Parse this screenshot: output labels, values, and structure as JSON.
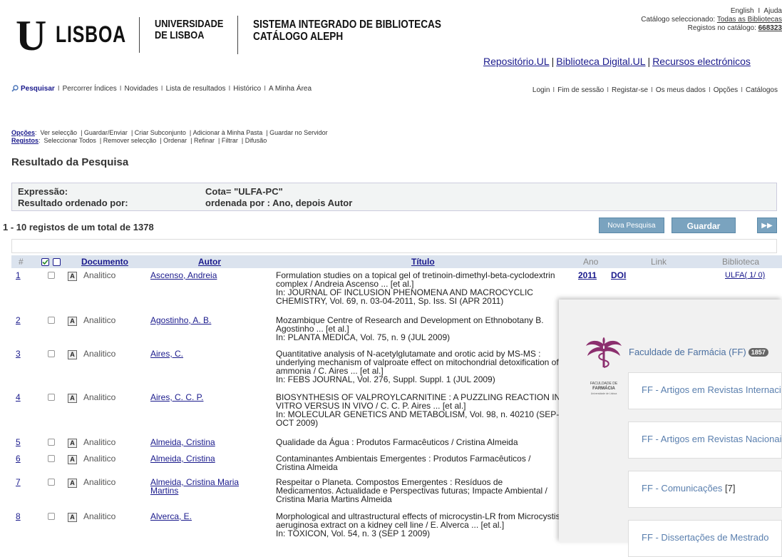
{
  "header": {
    "logo_u": "U",
    "logo_lisboa": "LISBOA",
    "university_line1": "UNIVERSIDADE",
    "university_line2": "DE LISBOA",
    "system_line1": "SISTEMA INTEGRADO DE BIBLIOTECAS",
    "system_line2": "CATÁLOGO ALEPH"
  },
  "top_right": {
    "english": "English",
    "help": "Ajuda",
    "catalog_label": "Catálogo seleccionado:",
    "catalog_value": "Todas as Bibliotecas",
    "records_label": "Registos no catálogo:",
    "records_value": "668323"
  },
  "resource_links": [
    "Repositório.UL",
    "Biblioteca Digital.UL",
    "Recursos electrónicos"
  ],
  "main_nav": [
    "Pesquisar",
    "Percorrer Índices",
    "Novidades",
    "Lista de resultados",
    "Histórico",
    "A Minha Área"
  ],
  "right_nav": [
    "Login",
    "Fim de sessão",
    "Registar-se",
    "Os meus dados",
    "Opções",
    "Catálogos"
  ],
  "options": {
    "label": "Opções",
    "items": [
      "Ver selecção",
      "Guardar/Enviar",
      "Criar Subconjunto",
      "Adicionar à Minha Pasta",
      "Guardar no Servidor"
    ]
  },
  "registos": {
    "label": "Registos",
    "items": [
      "Seleccionar Todos",
      "Remover selecção",
      "Ordenar",
      "Refinar",
      "Filtrar",
      "Difusão"
    ]
  },
  "result_title": "Resultado da Pesquisa",
  "expression": {
    "label": "Expressão:",
    "value": "Cota= \"ULFA-PC\"",
    "sort_label": "Resultado ordenado por:",
    "sort_value": "ordenada por : Ano, depois Autor"
  },
  "count_text": "1 - 10 registos de um total de 1378",
  "buttons": {
    "new_search": "Nova Pesquisa",
    "save": "Guardar",
    "next": "▶▶"
  },
  "table": {
    "headers": {
      "num": "#",
      "documento": "Documento",
      "autor": "Autor",
      "titulo": "Título",
      "ano": "Ano",
      "link": "Link",
      "biblioteca": "Biblioteca"
    },
    "rows": [
      {
        "num": "1",
        "doc": "Analitico",
        "autor": "Ascenso, Andreia",
        "titulo": "Formulation studies on a topical gel of tretinoin-dimethyl-beta-cyclodextrin complex / Andreia Ascenso ... [et al.]\nIn: JOURNAL OF INCLUSION PHENOMENA AND MACROCYCLIC CHEMISTRY, Vol. 69, n. 03-04-2011, Sp. Iss. SI (APR 2011)",
        "ano": "2011",
        "link": "DOI",
        "biblioteca": "ULFA( 1/ 0)"
      },
      {
        "num": "2",
        "doc": "Analitico",
        "autor": "Agostinho, A. B.",
        "titulo": "Mozambique Centre of Research and Development on Ethnobotany B. Agostinho ... [et al.]\nIn: PLANTA MEDICA, Vol. 75, n. 9 (JUL 2009)",
        "ano": "",
        "link": "",
        "biblioteca": ""
      },
      {
        "num": "3",
        "doc": "Analitico",
        "autor": "Aires, C.",
        "titulo": "Quantitative analysis of N-acetylglutamate and orotic acid by MS-MS : underlying mechanism of valproate effect on mitochondrial detoxification of ammonia / C. Aires ... [et al.]\nIn: FEBS JOURNAL, Vol. 276, Suppl. Suppl. 1 (JUL 2009)",
        "ano": "",
        "link": "",
        "biblioteca": ""
      },
      {
        "num": "4",
        "doc": "Analitico",
        "autor": "Aires, C. C. P.",
        "titulo": "BIOSYNTHESIS OF VALPROYLCARNITINE : A PUZZLING REACTION IN VITRO VERSUS IN VIVO / C. C. P. Aires ... [et al.]\nIn: MOLECULAR GENETICS AND METABOLISM, Vol. 98, n. 40210 (SEP-OCT 2009)",
        "ano": "",
        "link": "",
        "biblioteca": ""
      },
      {
        "num": "5",
        "doc": "Analitico",
        "autor": "Almeida, Cristina",
        "titulo": "Qualidade da Água : Produtos Farmacêuticos / Cristina Almeida",
        "ano": "",
        "link": "",
        "biblioteca": ""
      },
      {
        "num": "6",
        "doc": "Analitico",
        "autor": "Almeida, Cristina",
        "titulo": "Contaminantes Ambientais Emergentes : Produtos Farmacêuticos / Cristina Almeida",
        "ano": "",
        "link": "",
        "biblioteca": ""
      },
      {
        "num": "7",
        "doc": "Analitico",
        "autor": "Almeida, Cristina Maria Martins",
        "titulo": "Respeitar o Planeta. Compostos Emergentes : Resíduos de Medicamentos. Actualidade e Perspectivas futuras; Impacte Ambiental / Cristina Maria Martins Almeida",
        "ano": "",
        "link": "",
        "biblioteca": ""
      },
      {
        "num": "8",
        "doc": "Analitico",
        "autor": "Alverca, E.",
        "titulo": "Morphological and ultrastructural effects of microcystin-LR from Microcystis aeruginosa extract on a kidney cell line / E. Alverca ... [et al.]\nIn: TOXICON, Vol. 54, n. 3 (SEP 1 2009)",
        "ano": "",
        "link": "",
        "biblioteca": ""
      }
    ]
  },
  "overlay": {
    "faculty_title": "Faculdade de Farmácia (FF)",
    "faculty_count": "1857",
    "logo_text_line1": "FACULDADE DE",
    "logo_text_line2": "FARMÁCIA",
    "logo_text_line3": "Universidade de Lisboa",
    "cards": [
      {
        "label": "FF - Artigos em Revistas Internacionais",
        "count": ""
      },
      {
        "label": "FF - Artigos em Revistas Nacionais",
        "count": ""
      },
      {
        "label": "FF - Comunicações ",
        "count": "[7]"
      },
      {
        "label": "FF - Dissertações de Mestrado",
        "count": ""
      }
    ]
  }
}
